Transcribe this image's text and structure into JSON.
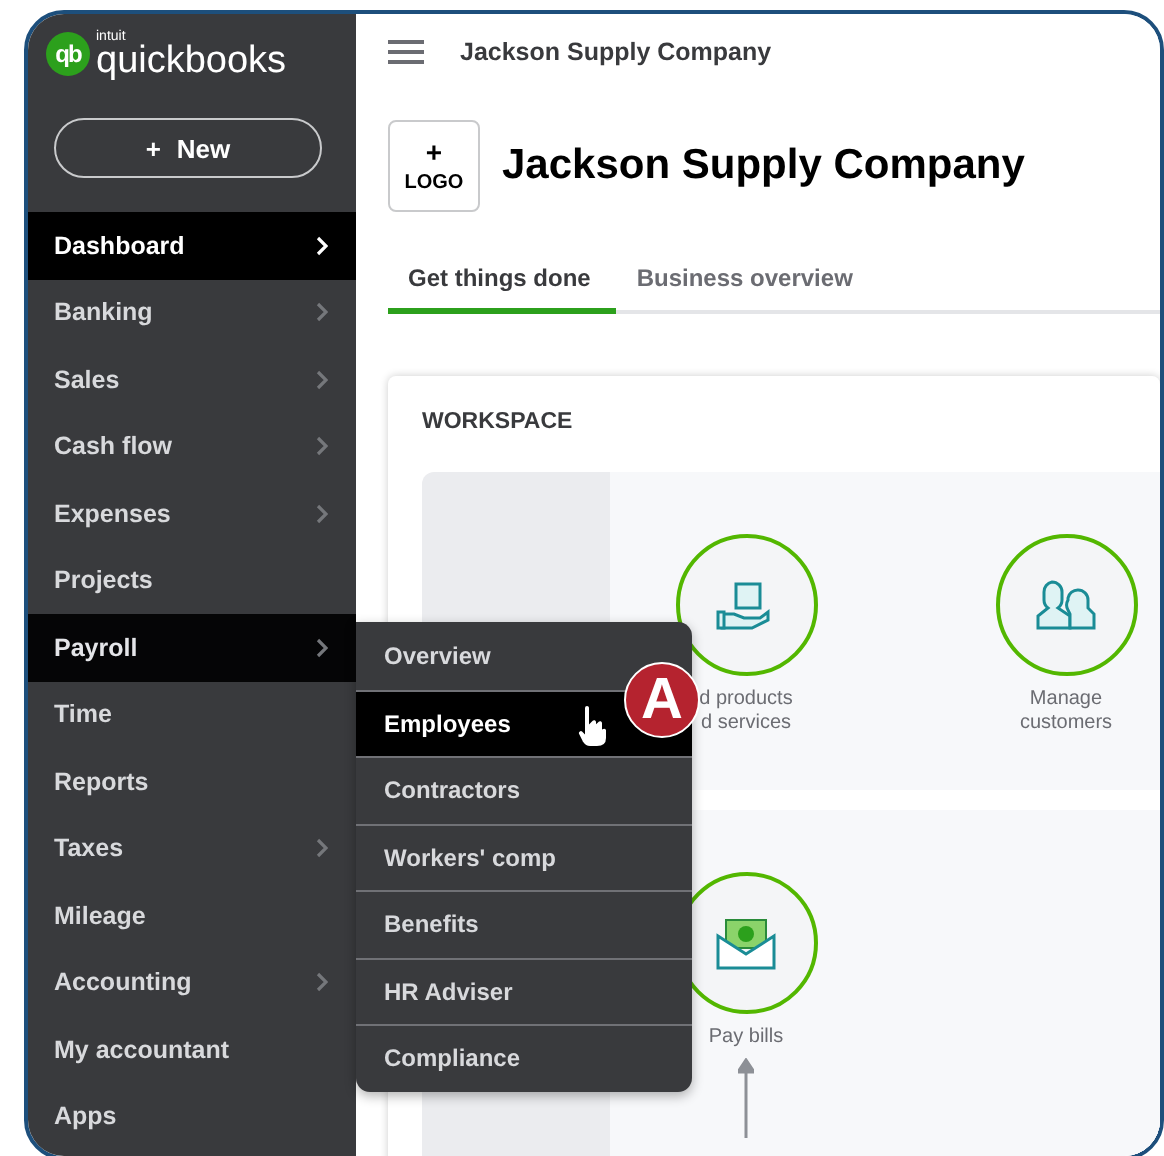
{
  "logo": {
    "mark": "qb",
    "maker": "intuit",
    "brand": "quickbooks"
  },
  "new_button": {
    "icon": "+",
    "label": "New"
  },
  "sidebar": {
    "items": [
      {
        "label": "Dashboard",
        "selected": true,
        "has_submenu": true
      },
      {
        "label": "Banking",
        "selected": false,
        "has_submenu": true
      },
      {
        "label": "Sales",
        "selected": false,
        "has_submenu": true
      },
      {
        "label": "Cash flow",
        "selected": false,
        "has_submenu": true
      },
      {
        "label": "Expenses",
        "selected": false,
        "has_submenu": true
      },
      {
        "label": "Projects",
        "selected": false,
        "has_submenu": false
      },
      {
        "label": "Payroll",
        "selected": false,
        "hovered": true,
        "has_submenu": true
      },
      {
        "label": "Time",
        "selected": false,
        "has_submenu": false
      },
      {
        "label": "Reports",
        "selected": false,
        "has_submenu": false
      },
      {
        "label": "Taxes",
        "selected": false,
        "has_submenu": true
      },
      {
        "label": "Mileage",
        "selected": false,
        "has_submenu": false
      },
      {
        "label": "Accounting",
        "selected": false,
        "has_submenu": true
      },
      {
        "label": "My accountant",
        "selected": false,
        "has_submenu": false
      },
      {
        "label": "Apps",
        "selected": false,
        "has_submenu": false
      }
    ]
  },
  "header": {
    "company": "Jackson Supply Company"
  },
  "logo_box": {
    "icon": "+",
    "label": "LOGO"
  },
  "page_title": "Jackson Supply Company",
  "tabs": [
    {
      "label": "Get things done",
      "selected": true
    },
    {
      "label": "Business overview",
      "selected": false
    }
  ],
  "workspace": {
    "title": "WORKSPACE",
    "rows": [
      {
        "tiles": [
          {
            "kind": "products",
            "lines": [
              "d products",
              "d services"
            ]
          },
          {
            "kind": "customers",
            "lines": [
              "Manage",
              "customers"
            ]
          }
        ]
      },
      {
        "tiles": [
          {
            "kind": "bills",
            "lines": [
              "Pay bills"
            ]
          }
        ]
      }
    ]
  },
  "submenu": {
    "items": [
      {
        "label": "Overview",
        "selected": false
      },
      {
        "label": "Employees",
        "selected": true
      },
      {
        "label": "Contractors",
        "selected": false
      },
      {
        "label": "Workers' comp",
        "selected": false
      },
      {
        "label": "Benefits",
        "selected": false
      },
      {
        "label": "HR Adviser",
        "selected": false
      },
      {
        "label": "Compliance",
        "selected": false
      }
    ]
  },
  "callout": {
    "label": "A"
  }
}
